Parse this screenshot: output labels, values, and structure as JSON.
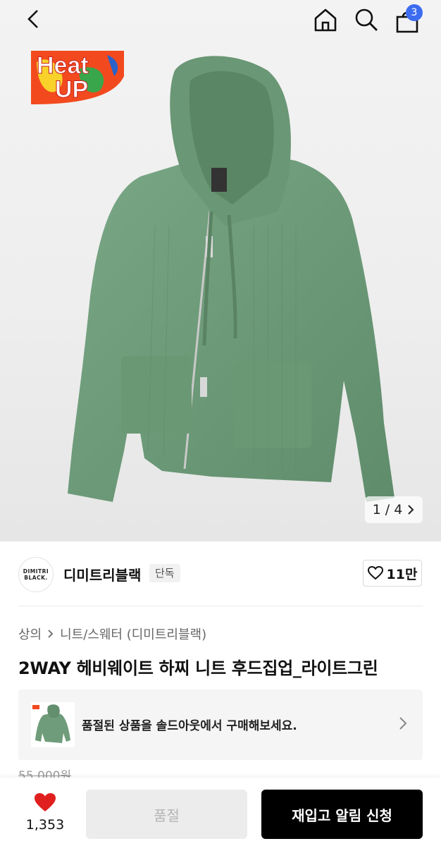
{
  "header": {
    "cart_count": "3"
  },
  "hero": {
    "badge_line1": "Heat",
    "badge_line2": "UP",
    "pager_current": "1",
    "pager_sep": "/",
    "pager_total": "4"
  },
  "brand": {
    "logo_line1": "DIMITRI",
    "logo_line2": "BLACK.",
    "name": "디미트리블랙",
    "tag": "단독",
    "like_count": "11만"
  },
  "breadcrumb": {
    "category": "상의",
    "subcategory": "니트/스웨터 (디미트리블랙)"
  },
  "product": {
    "title": "2WAY 헤비웨이트 하찌 니트 후드집업_라이트그린",
    "soldout_message": "품절된 상품을 솔드아웃에서 구매해보세요.",
    "price": "55,000원"
  },
  "bottom": {
    "like_count": "1,353",
    "soldout_label": "품절",
    "restock_label": "재입고 알림 신청"
  },
  "colors": {
    "hoodie_green": "#6f9c7a",
    "cart_badge": "#3d6cf0",
    "heart_red": "#e0201f"
  }
}
